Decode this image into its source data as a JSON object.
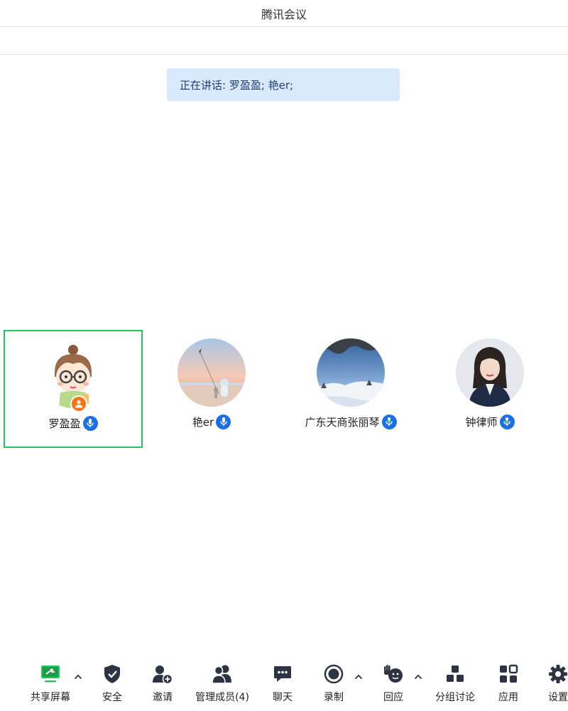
{
  "window": {
    "title": "腾讯会议"
  },
  "speaking_banner": {
    "text": "正在讲话: 罗盈盈; 艳er;"
  },
  "participants": [
    {
      "name": "罗盈盈",
      "mic": "mic-on",
      "host": true,
      "active": true
    },
    {
      "name": "艳er",
      "mic": "mic-on",
      "host": false,
      "active": false
    },
    {
      "name": "广东天商张丽琴",
      "mic": "mic-speaking",
      "host": false,
      "active": false
    },
    {
      "name": "钟律师",
      "mic": "mic-speaking",
      "host": false,
      "active": false
    }
  ],
  "toolbar": {
    "share_screen": "共享屏幕",
    "security": "安全",
    "invite": "邀请",
    "manage_members": "管理成员(4)",
    "chat": "聊天",
    "record": "录制",
    "react": "回应",
    "breakout": "分组讨论",
    "apps": "应用",
    "settings": "设置"
  },
  "colors": {
    "accent_green": "#22c55e",
    "mic_blue": "#1b6fe8",
    "banner_bg": "#d8e9fe",
    "host_orange": "#f97316",
    "icon_dark": "#2d3340"
  }
}
